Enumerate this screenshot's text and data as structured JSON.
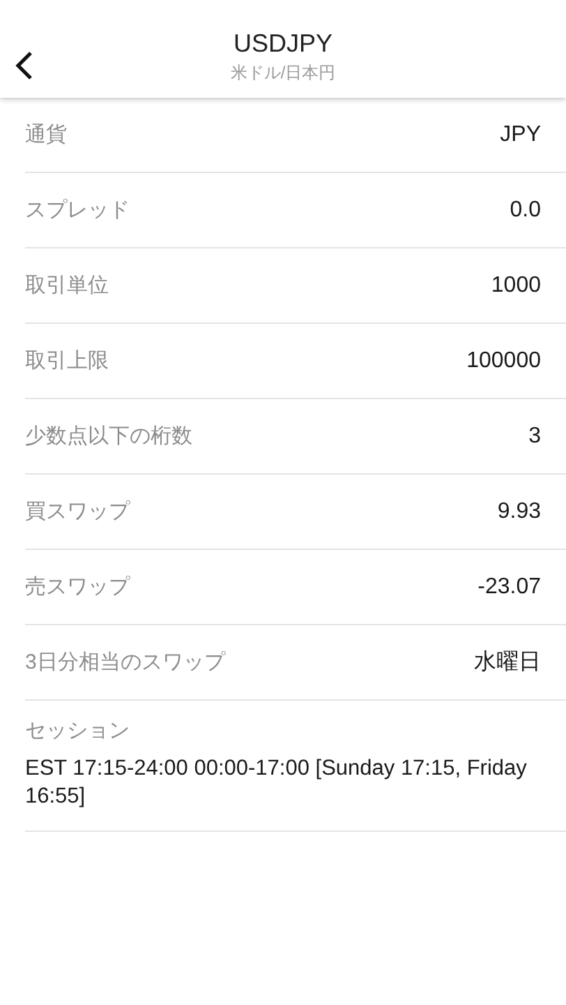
{
  "header": {
    "title": "USDJPY",
    "subtitle": "米ドル/日本円"
  },
  "rows": [
    {
      "label": "通貨",
      "value": "JPY"
    },
    {
      "label": "スプレッド",
      "value": "0.0"
    },
    {
      "label": "取引単位",
      "value": "1000"
    },
    {
      "label": "取引上限",
      "value": "100000"
    },
    {
      "label": "少数点以下の桁数",
      "value": "3"
    },
    {
      "label": "買スワップ",
      "value": "9.93"
    },
    {
      "label": "売スワップ",
      "value": "-23.07"
    },
    {
      "label": "3日分相当のスワップ",
      "value": "水曜日"
    }
  ],
  "session": {
    "label": "セッション",
    "value": "EST 17:15-24:00 00:00-17:00 [Sunday 17:15, Friday 16:55]"
  }
}
